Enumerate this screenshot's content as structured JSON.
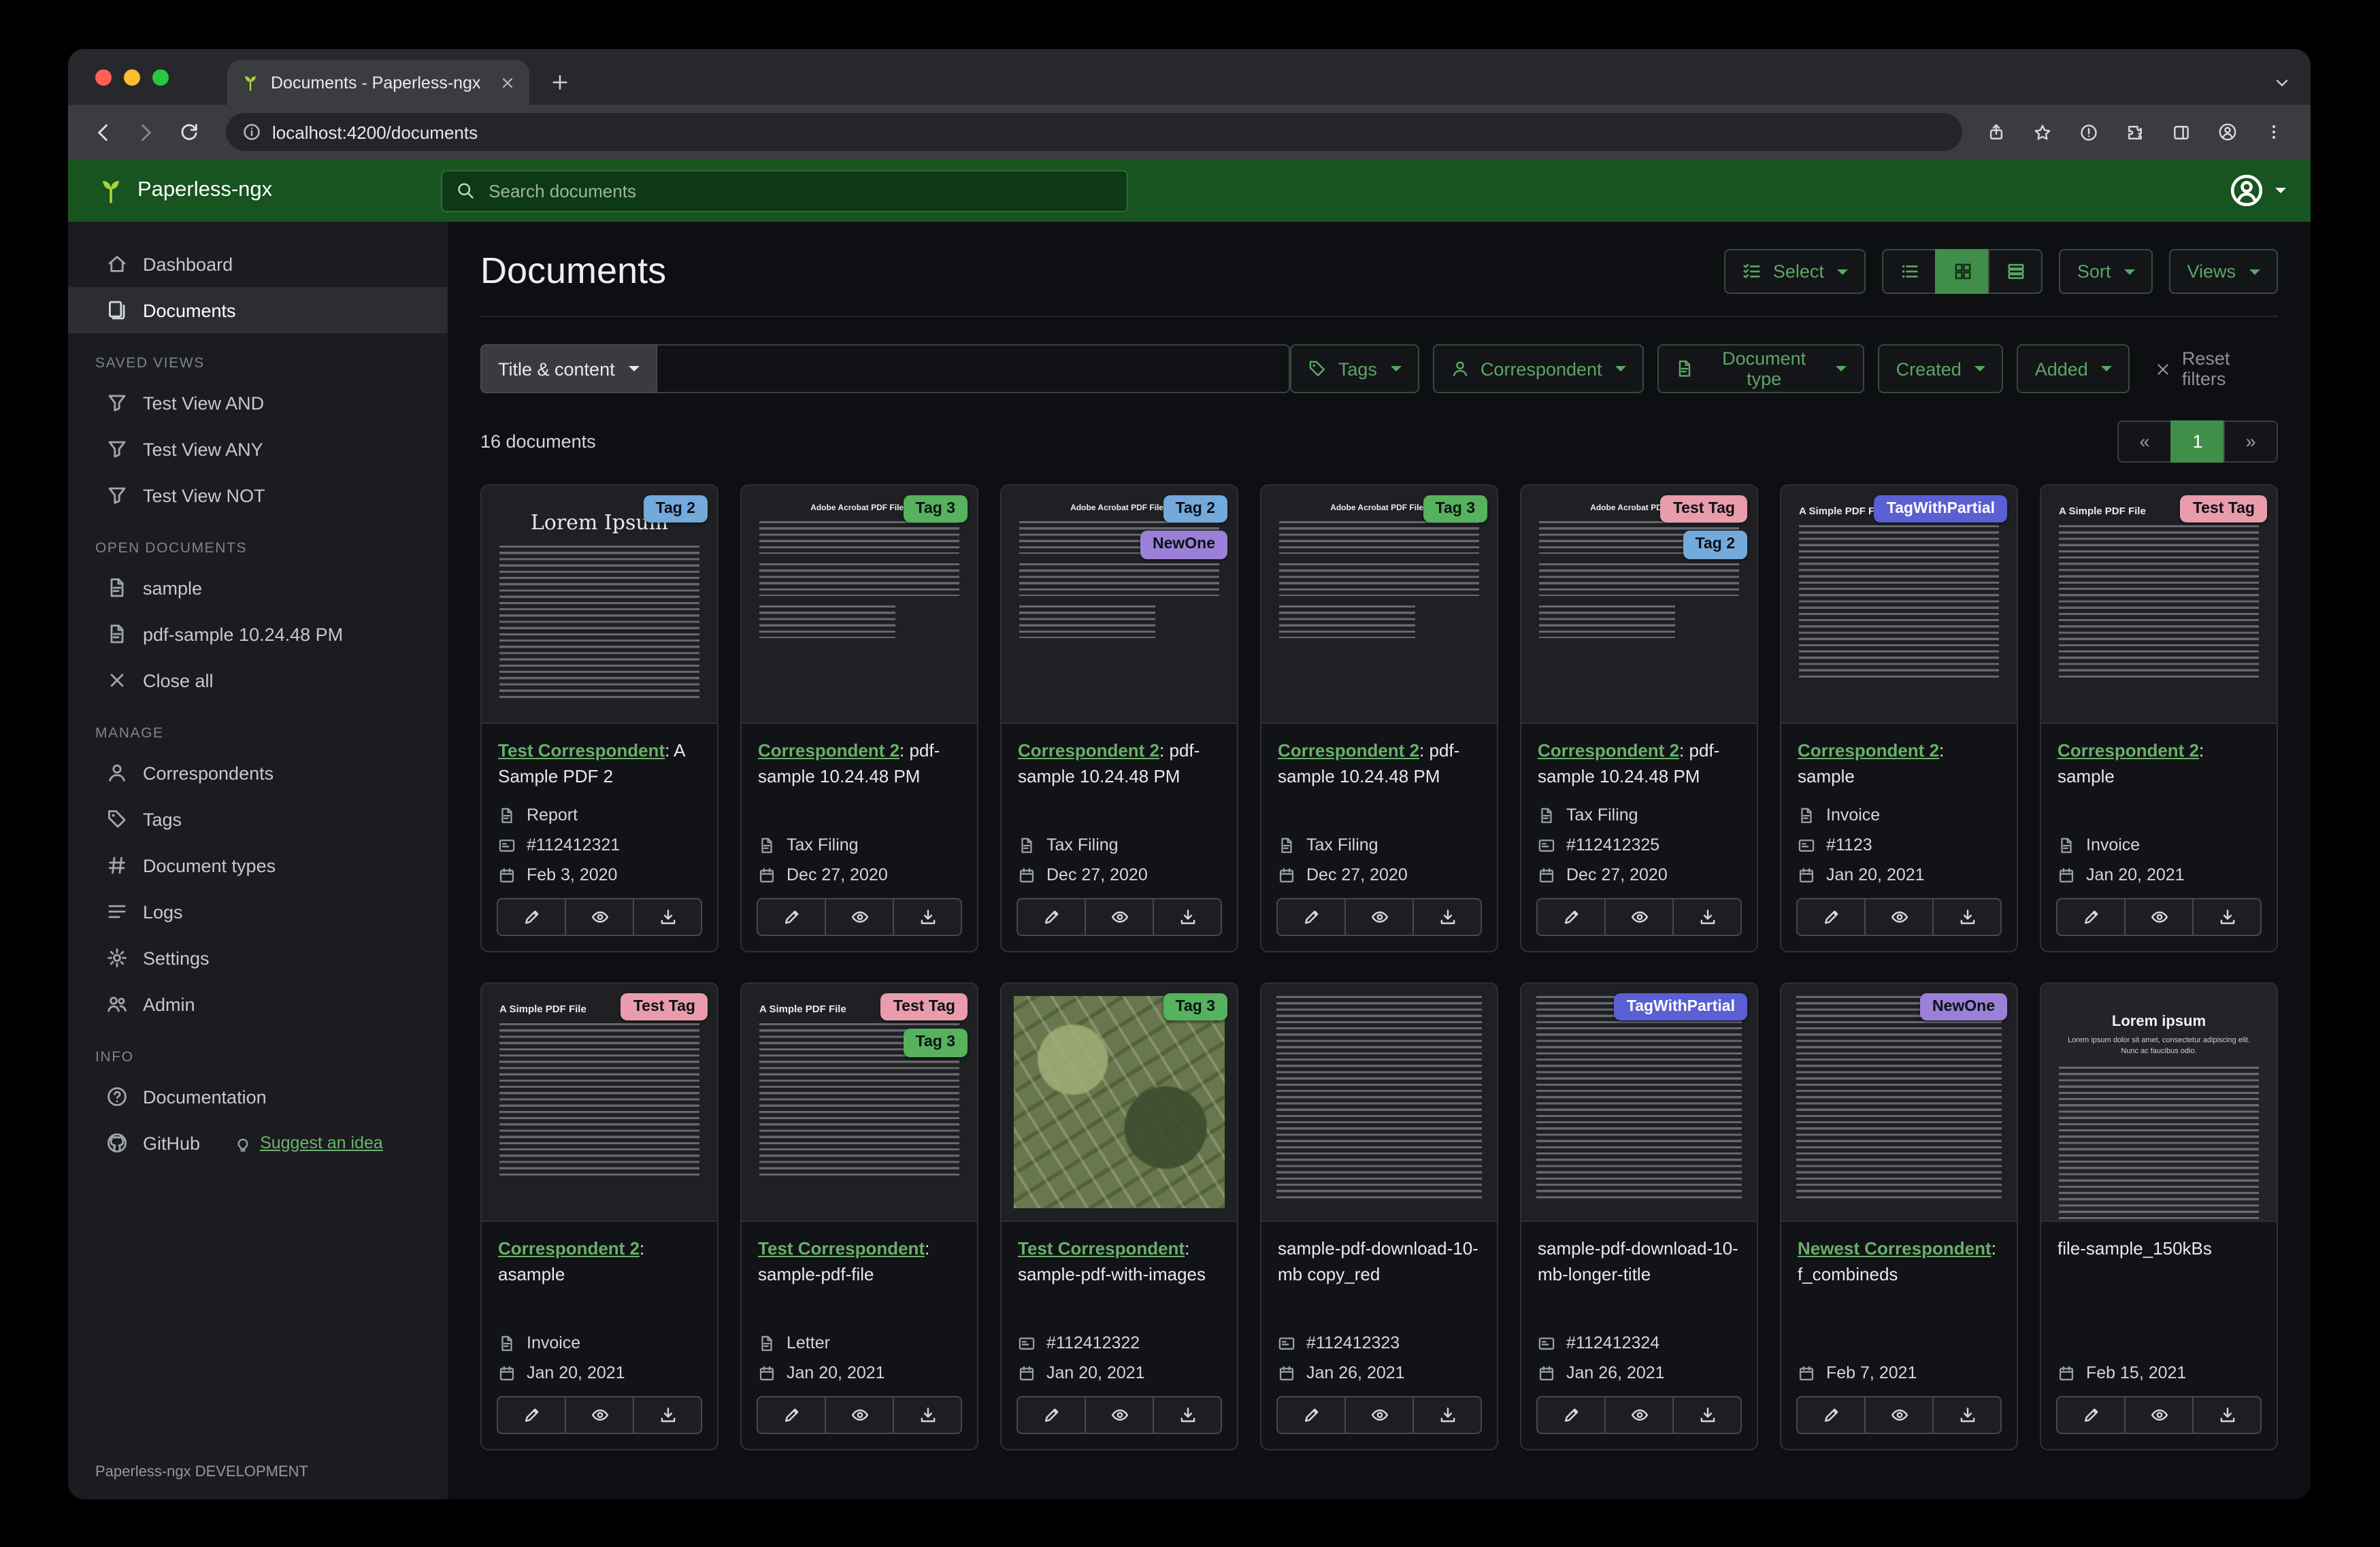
{
  "browser": {
    "tab_title": "Documents - Paperless-ngx",
    "url": "localhost:4200/documents"
  },
  "header": {
    "brand": "Paperless-ngx",
    "search_placeholder": "Search documents"
  },
  "sidebar": {
    "top": [
      {
        "label": "Dashboard",
        "icon": "house"
      },
      {
        "label": "Documents",
        "icon": "files",
        "active": true
      }
    ],
    "sections": [
      {
        "title": "SAVED VIEWS",
        "items": [
          {
            "label": "Test View AND",
            "icon": "funnel"
          },
          {
            "label": "Test View ANY",
            "icon": "funnel"
          },
          {
            "label": "Test View NOT",
            "icon": "funnel"
          }
        ]
      },
      {
        "title": "OPEN DOCUMENTS",
        "items": [
          {
            "label": "sample",
            "icon": "filetext"
          },
          {
            "label": "pdf-sample 10.24.48 PM",
            "icon": "filetext"
          },
          {
            "label": "Close all",
            "icon": "x"
          }
        ]
      },
      {
        "title": "MANAGE",
        "items": [
          {
            "label": "Correspondents",
            "icon": "person"
          },
          {
            "label": "Tags",
            "icon": "tag"
          },
          {
            "label": "Document types",
            "icon": "hash"
          },
          {
            "label": "Logs",
            "icon": "listlines"
          },
          {
            "label": "Settings",
            "icon": "gear"
          },
          {
            "label": "Admin",
            "icon": "users"
          }
        ]
      },
      {
        "title": "INFO",
        "items": [
          {
            "label": "Documentation",
            "icon": "question"
          },
          {
            "label": "GitHub",
            "icon": "github",
            "extra_link": {
              "label": "Suggest an idea",
              "icon": "bulb"
            }
          }
        ]
      }
    ],
    "footer": "Paperless-ngx DEVELOPMENT"
  },
  "page": {
    "title": "Documents",
    "select_label": "Select",
    "sort_label": "Sort",
    "views_label": "Views",
    "field_label": "Title & content",
    "reset_label": "Reset filters",
    "count_text": "16 documents",
    "filters": [
      {
        "label": "Tags",
        "icon": "tag"
      },
      {
        "label": "Correspondent",
        "icon": "person"
      },
      {
        "label": "Document type",
        "icon": "filetext"
      },
      {
        "label": "Created"
      },
      {
        "label": "Added"
      }
    ],
    "pagination": {
      "prev": "«",
      "page": "1",
      "next": "»"
    }
  },
  "colors": {
    "header_green": "#17541f",
    "link_green": "#68b06a",
    "active_green": "#3f8f4a"
  },
  "tag_colors": {
    "Tag 2": {
      "bg": "#74a9dc",
      "fg": "#0d1117"
    },
    "Tag 3": {
      "bg": "#56b25c",
      "fg": "#0d1117"
    },
    "NewOne": {
      "bg": "#9b80d7",
      "fg": "#0d1117"
    },
    "Test Tag": {
      "bg": "#e99cab",
      "fg": "#0d1117"
    },
    "TagWithPartial": {
      "bg": "#5a5fd3",
      "fg": "#ffffff"
    }
  },
  "thumb_styles": {
    "lorem": {
      "heading": "Lorem Ipsum"
    },
    "acrobat": {
      "heading": "Adobe Acrobat PDF Files"
    },
    "simple": {
      "heading": "A Simple PDF File"
    },
    "map": {
      "heading": ""
    },
    "dense": {
      "heading": ""
    },
    "white": {
      "heading": "Lorem ipsum",
      "subheading": "Lorem ipsum dolor sit amet, consectetur adipiscing elit. Nunc ac faucibus odio."
    }
  },
  "documents": [
    {
      "thumb": "lorem",
      "tags": [
        "Tag 2"
      ],
      "correspondent": "Test Correspondent",
      "title_rest": ": A Sample PDF 2",
      "type": "Report",
      "asn": "#112412321",
      "date": "Feb 3, 2020"
    },
    {
      "thumb": "acrobat",
      "tags": [
        "Tag 3"
      ],
      "correspondent": "Correspondent 2",
      "title_rest": ": pdf-sample 10.24.48 PM",
      "type": "Tax Filing",
      "date": "Dec 27, 2020"
    },
    {
      "thumb": "acrobat",
      "tags": [
        "Tag 2",
        "NewOne"
      ],
      "correspondent": "Correspondent 2",
      "title_rest": ": pdf-sample 10.24.48 PM",
      "type": "Tax Filing",
      "date": "Dec 27, 2020"
    },
    {
      "thumb": "acrobat",
      "tags": [
        "Tag 3"
      ],
      "correspondent": "Correspondent 2",
      "title_rest": ": pdf-sample 10.24.48 PM",
      "type": "Tax Filing",
      "date": "Dec 27, 2020"
    },
    {
      "thumb": "acrobat",
      "tags": [
        "Test Tag",
        "Tag 2"
      ],
      "correspondent": "Correspondent 2",
      "title_rest": ": pdf-sample 10.24.48 PM",
      "type": "Tax Filing",
      "asn": "#112412325",
      "date": "Dec 27, 2020"
    },
    {
      "thumb": "simple",
      "tags": [
        "TagWithPartial"
      ],
      "correspondent": "Correspondent 2",
      "title_rest": ": sample",
      "type": "Invoice",
      "asn": "#1123",
      "date": "Jan 20, 2021"
    },
    {
      "thumb": "simple",
      "tags": [
        "Test Tag"
      ],
      "correspondent": "Correspondent 2",
      "title_rest": ": sample",
      "type": "Invoice",
      "date": "Jan 20, 2021"
    },
    {
      "thumb": "simple",
      "tags": [
        "Test Tag"
      ],
      "correspondent": "Correspondent 2",
      "title_rest": ": asample",
      "type": "Invoice",
      "date": "Jan 20, 2021"
    },
    {
      "thumb": "simple",
      "tags": [
        "Test Tag",
        "Tag 3"
      ],
      "correspondent": "Test Correspondent",
      "title_rest": ": sample-pdf-file",
      "type": "Letter",
      "date": "Jan 20, 2021"
    },
    {
      "thumb": "map",
      "tags": [
        "Tag 3"
      ],
      "correspondent": "Test Correspondent",
      "title_rest": ": sample-pdf-with-images",
      "asn": "#112412322",
      "date": "Jan 20, 2021"
    },
    {
      "thumb": "dense",
      "tags": [],
      "title": "sample-pdf-download-10-mb copy_red",
      "asn": "#112412323",
      "date": "Jan 26, 2021"
    },
    {
      "thumb": "dense",
      "tags": [
        "TagWithPartial"
      ],
      "title": "sample-pdf-download-10-mb-longer-title",
      "asn": "#112412324",
      "date": "Jan 26, 2021"
    },
    {
      "thumb": "dense",
      "tags": [
        "NewOne"
      ],
      "correspondent": "Newest Correspondent",
      "title_rest": ": f_combineds",
      "date": "Feb 7, 2021"
    },
    {
      "thumb": "white",
      "tags": [],
      "title": "file-sample_150kBs",
      "date": "Feb 15, 2021"
    }
  ]
}
